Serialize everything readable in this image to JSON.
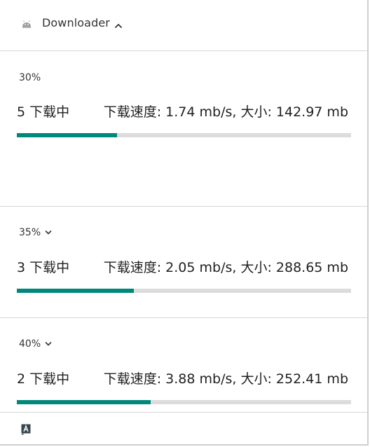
{
  "header": {
    "app_icon": "android-icon",
    "app_name": "Downloader",
    "expand_icon": "chevron-up-icon"
  },
  "notifications": [
    {
      "percent_label": "30%",
      "progress": 0.3,
      "count_label": "5 下载中",
      "speed_label": "下载速度: 1.74 mb/s, 大小: 142.97 mb",
      "has_expand_chevron": false
    },
    {
      "percent_label": "35%",
      "progress": 0.35,
      "count_label": "3 下载中",
      "speed_label": "下载速度: 2.05 mb/s, 大小: 288.65 mb",
      "has_expand_chevron": true
    },
    {
      "percent_label": "40%",
      "progress": 0.4,
      "count_label": "2 下载中",
      "speed_label": "下载速度: 3.88 mb/s, 大小: 252.41 mb",
      "has_expand_chevron": true
    }
  ],
  "footer": {
    "icon": "font-a-icon"
  },
  "colors": {
    "progress_fill": "#00897b",
    "progress_track": "#dcdcdc",
    "divider": "#d6d6d6"
  }
}
